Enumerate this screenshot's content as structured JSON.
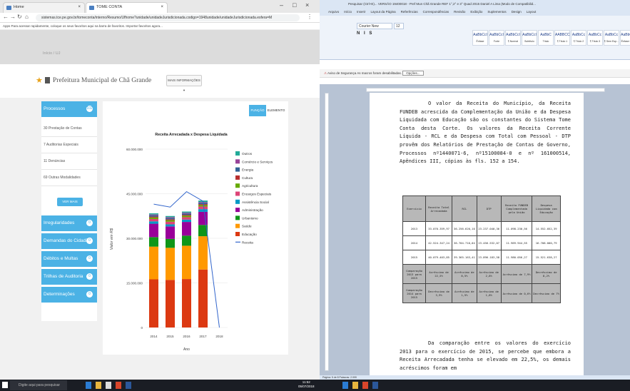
{
  "browser": {
    "tabs": [
      {
        "label": "Home"
      },
      {
        "label": "TOME CONTA"
      }
    ],
    "url": "sistemas.tce.pe.gov.br/tomeconta/interno/Resumo/Ufhome?unidade/unidadeJurisdicionada.codigo=1948unidade/unidadeJurisdicionada.esfera=M",
    "bookmarks": "Apps  Para acessar rapidamente, coloque os seus favoritos aqui na barra de favoritos. Importar favoritos agora...",
    "window_controls": [
      "–",
      "□",
      "×"
    ]
  },
  "site": {
    "breadcrumb": "Início / UJ",
    "page_title": "Prefeitura Municipal de Chã Grande",
    "more_info_button": "MAIS INFORMAÇÕES ▾",
    "tab_function": "FUNÇÃO",
    "tab_element": "ELEMENTO",
    "see_more_button": "VER MAIS",
    "sidebar": {
      "processos": {
        "label": "Processos",
        "count": "102"
      },
      "items": [
        "30 Prestação de Contas",
        "7 Auditorias Especiais",
        "11 Denúncias",
        "69 Outras Modalidades"
      ],
      "sections": [
        {
          "label": "Irregularidades",
          "count": "0"
        },
        {
          "label": "Demandas do Cidadão",
          "count": "0"
        },
        {
          "label": "Débitos e Multas",
          "count": "0"
        },
        {
          "label": "Trilhas de Auditoria",
          "count": "0"
        },
        {
          "label": "Determinações",
          "count": "0"
        }
      ]
    }
  },
  "chart_data": {
    "type": "bar",
    "title": "Receita Arrecadada x Despesa Liquidada",
    "xlabel": "Ano",
    "ylabel": "Valor em R$",
    "categories": [
      "2014",
      "2015",
      "2016",
      "2017",
      "2018"
    ],
    "yticks": [
      "0",
      "15.000.000",
      "30.000.000",
      "45.000.000",
      "60.000.000"
    ],
    "ylim": [
      0,
      60000000
    ],
    "stacked": true,
    "series": [
      {
        "name": "Educação",
        "color": "#dc3912",
        "values": [
          16200000,
          16000000,
          16300000,
          19500000,
          0
        ]
      },
      {
        "name": "Saúde",
        "color": "#ff9900",
        "values": [
          11000000,
          10800000,
          11200000,
          11200000,
          0
        ]
      },
      {
        "name": "Urbanismo",
        "color": "#109618",
        "values": [
          3200000,
          3000000,
          3400000,
          3800000,
          0
        ]
      },
      {
        "name": "Administração",
        "color": "#990099",
        "values": [
          4500000,
          4200000,
          4600000,
          4400000,
          0
        ]
      },
      {
        "name": "Assistência Social",
        "color": "#0099c6",
        "values": [
          800000,
          700000,
          800000,
          900000,
          0
        ]
      },
      {
        "name": "Encargos Especiais",
        "color": "#dd4477",
        "values": [
          800000,
          900000,
          800000,
          900000,
          0
        ]
      },
      {
        "name": "Agricultura",
        "color": "#66aa00",
        "values": [
          500000,
          500000,
          500000,
          500000,
          0
        ]
      },
      {
        "name": "Cultura",
        "color": "#b82e2e",
        "values": [
          300000,
          300000,
          300000,
          300000,
          0
        ]
      },
      {
        "name": "Energia",
        "color": "#316395",
        "values": [
          400000,
          400000,
          400000,
          400000,
          0
        ]
      },
      {
        "name": "Comércio e Serviços",
        "color": "#994499",
        "values": [
          300000,
          300000,
          300000,
          300000,
          0
        ]
      },
      {
        "name": "Outros",
        "color": "#22aa99",
        "values": [
          400000,
          400000,
          400000,
          500000,
          0
        ]
      }
    ],
    "line": {
      "name": "Receita",
      "color": "#3366cc",
      "values": [
        41500000,
        40500000,
        45700000,
        42500000,
        0
      ]
    }
  },
  "word": {
    "title": "Pesquisar (Ctrl+E)... VERSÃO 19400018 - Pref Mun Chã Grande REF 1°,2° e 3° Quad 2015 Daniel A Lima (Modo de Compatibilid...",
    "ribbon_tabs": [
      "Arquivo",
      "Início",
      "Inserir",
      "Layout da Página",
      "Referências",
      "Correspondências",
      "Revisão",
      "Exibição",
      "Suplementos",
      "Design",
      "Layout"
    ],
    "font_name": "Courier New",
    "font_size": "12",
    "styles": [
      {
        "preview": "AaBbCcI",
        "name": "Ênfase"
      },
      {
        "preview": "AaBbCcI",
        "name": "Forte"
      },
      {
        "preview": "AaBbCcI",
        "name": "¶ Normal"
      },
      {
        "preview": "AaBbCcI",
        "name": "Subtítulo"
      },
      {
        "preview": "AaBbC",
        "name": "Título"
      },
      {
        "preview": "AABBCC",
        "name": "¶ Título 1"
      },
      {
        "preview": "AaBbCc",
        "name": "¶ Título 2"
      },
      {
        "preview": "AaBbCc",
        "name": "¶ Título 3"
      },
      {
        "preview": "AaBbCc",
        "name": "¶ Sem Esp..."
      },
      {
        "preview": "AaBbCcI",
        "name": "Ênfase Sutil"
      }
    ],
    "security_warning": "Aviso de Segurança  As macros foram desabilitadas.",
    "security_options": "Opções...",
    "paragraph1": "O valor da Receita do Município, da Receita FUNDEB acrescida da Complementação da União e da Despesa Liquidada com Educação são os constantes do Sistema Tome Conta desta Corte. Os valores da Receita Corrente Líquida - RCL e da Despesa com Total com Pessoal - DTP provêm dos Relatórios de Prestação de Contas de Governo, Processos nº1440071-6, nº15100084-0 e nº 161000514, Apêndices III, cópias às fls. 152 a 154.",
    "paragraph2": "Da comparação entre os valores do exercício 2013 para o exercício de 2015, se percebe que embora a Receita Arrecadada tenha se elevado em 22,5%, os demais acréscimos foram em",
    "table": {
      "headers": [
        "Exercício",
        "Receita Total Arrecadada",
        "RCL",
        "DTP",
        "Receita FUNDEB Complementada pela União",
        "Despesa Liquidada com Educação"
      ],
      "rows": [
        [
          "2013",
          "33.070.359,97",
          "36.256.620,10",
          "23.237.040,36",
          "11.098.230,56",
          "14.552.052,39"
        ],
        [
          "2014",
          "42.524.347,24",
          "36.704.710,04",
          "23.456.532,07",
          "11.969.944,55",
          "16.708.000,79"
        ],
        [
          "2015",
          "40.079.403,85",
          "39.365.163,41",
          "23.896.183,58",
          "11.980.056,27",
          "15.521.638,27"
        ],
        [
          "Comparação 2013 para 2015",
          "Acréscimo de 22,5%",
          "Acréscimo de 8,5%",
          "Acréscimo de 2,8%",
          "Acréscimo de 7,9%",
          "Decréscimo de 8,2%"
        ],
        [
          "Comparação 2014 para 2015",
          "Decréscimo de 3,9%",
          "Acréscimo de 1,5%",
          "Acréscimo de 1,8%",
          "Acréscimo de 0,6%",
          "Decréscimo de 7%"
        ]
      ]
    },
    "status": "Página: 5 de 8   Palavras: 2.999"
  },
  "taskbar": {
    "search_placeholder": "Digite aqui para pesquisar",
    "time": "11:52",
    "date": "05/07/2018"
  }
}
